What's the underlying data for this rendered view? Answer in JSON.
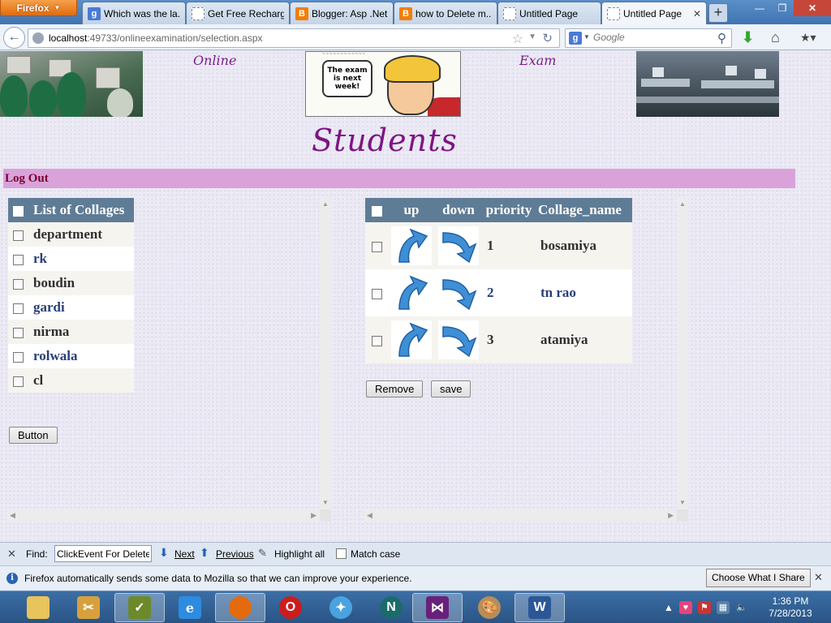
{
  "browser": {
    "menu_button": "Firefox",
    "tabs": [
      {
        "title": "Which was the la...",
        "icon": "google-icon"
      },
      {
        "title": "Get Free Recharg...",
        "icon": "blank-page-icon"
      },
      {
        "title": "Blogger: Asp .Net...",
        "icon": "blogger-icon"
      },
      {
        "title": "how to Delete m...",
        "icon": "blogger-icon"
      },
      {
        "title": "Untitled Page",
        "icon": "blank-page-icon"
      },
      {
        "title": "Untitled Page",
        "icon": "blank-page-icon",
        "active": true
      }
    ],
    "url_host": "localhost",
    "url_rest": ":49733/onlineexamination/selection.aspx",
    "search_placeholder": "Google"
  },
  "page": {
    "header_word_left": "Online",
    "header_word_right": "Exam",
    "comic_text": "The exam is next week!",
    "title": "Students",
    "logout": "Log Out",
    "colleges_header": "List of Collages",
    "colleges": [
      "department",
      "rk",
      "boudin",
      "gardi",
      "nirma",
      "rolwala",
      "cl"
    ],
    "left_button": "Button",
    "priority_headers": {
      "up": "up",
      "down": "down",
      "priority": "priority",
      "name": "Collage_name"
    },
    "priority_rows": [
      {
        "priority": "1",
        "name": "bosamiya"
      },
      {
        "priority": "2",
        "name": "tn rao"
      },
      {
        "priority": "3",
        "name": "atamiya"
      }
    ],
    "remove_button": "Remove",
    "save_button": "save"
  },
  "findbar": {
    "label": "Find:",
    "value": "ClickEvent For Delete:-",
    "next": "Next",
    "previous": "Previous",
    "highlight": "Highlight all",
    "match_case": "Match case"
  },
  "notification": {
    "message": "Firefox automatically sends some data to Mozilla so that we can improve your experience.",
    "button": "Choose What I Share"
  },
  "taskbar": {
    "time": "1:36 PM",
    "date": "7/28/2013"
  },
  "colors": {
    "title": "#7d1585",
    "logout_bar": "#d9a3da",
    "table_header": "#5f7c96"
  }
}
